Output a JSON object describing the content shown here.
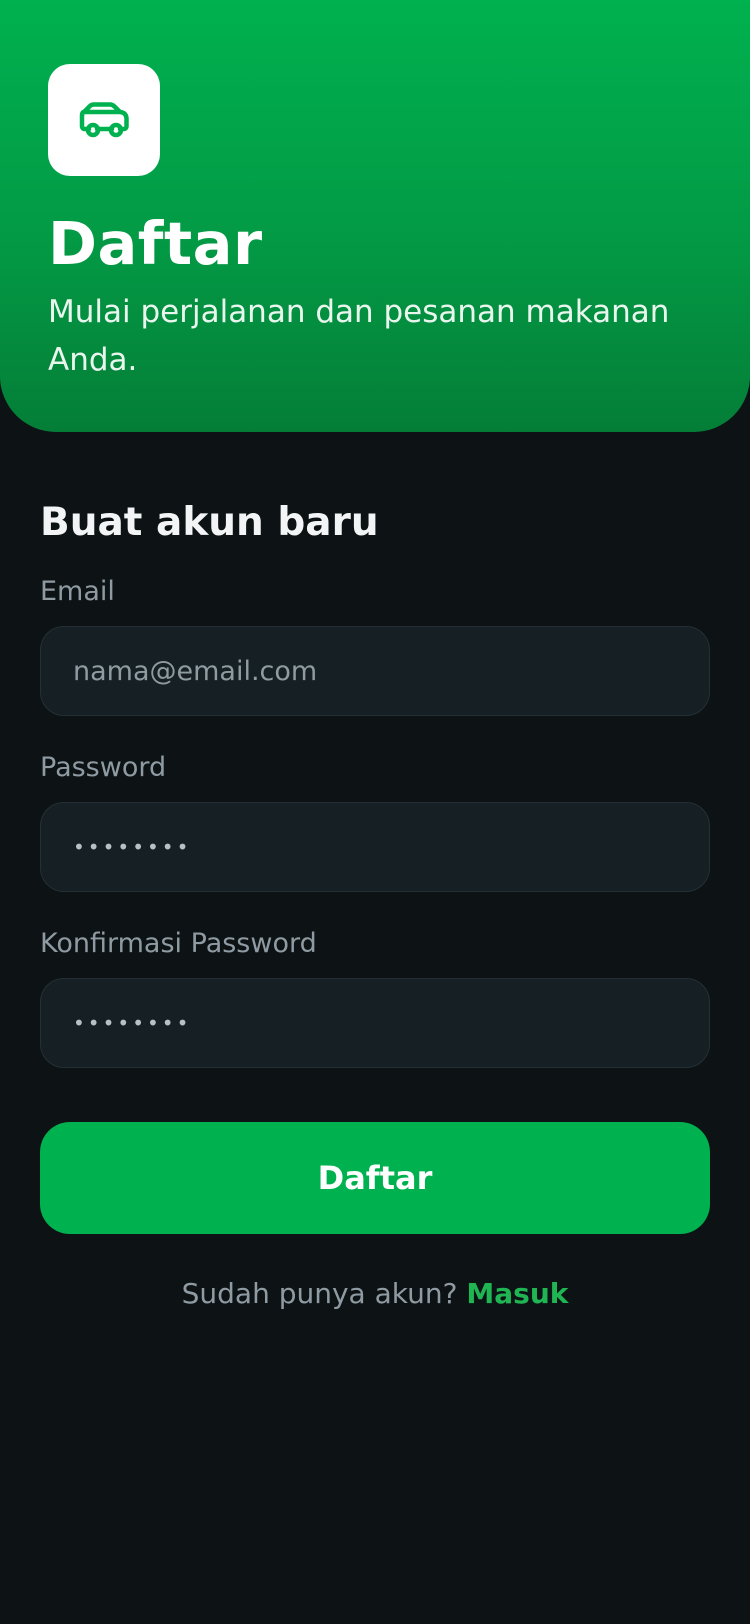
{
  "header": {
    "icon": "car-icon",
    "title": "Daftar",
    "subtitle": "Mulai perjalanan dan pesanan makanan Anda."
  },
  "form": {
    "heading": "Buat akun baru",
    "email": {
      "label": "Email",
      "placeholder": "nama@email.com",
      "value": ""
    },
    "password": {
      "label": "Password",
      "value": "••••••••"
    },
    "confirm_password": {
      "label": "Konfirmasi Password",
      "value": "••••••••"
    },
    "submit_label": "Daftar"
  },
  "footer": {
    "prompt": "Sudah punya akun?",
    "link_label": "Masuk"
  },
  "colors": {
    "brand_green": "#00b14f",
    "background": "#0d1215",
    "input_background": "#161f23",
    "link_green": "#1fb553"
  }
}
